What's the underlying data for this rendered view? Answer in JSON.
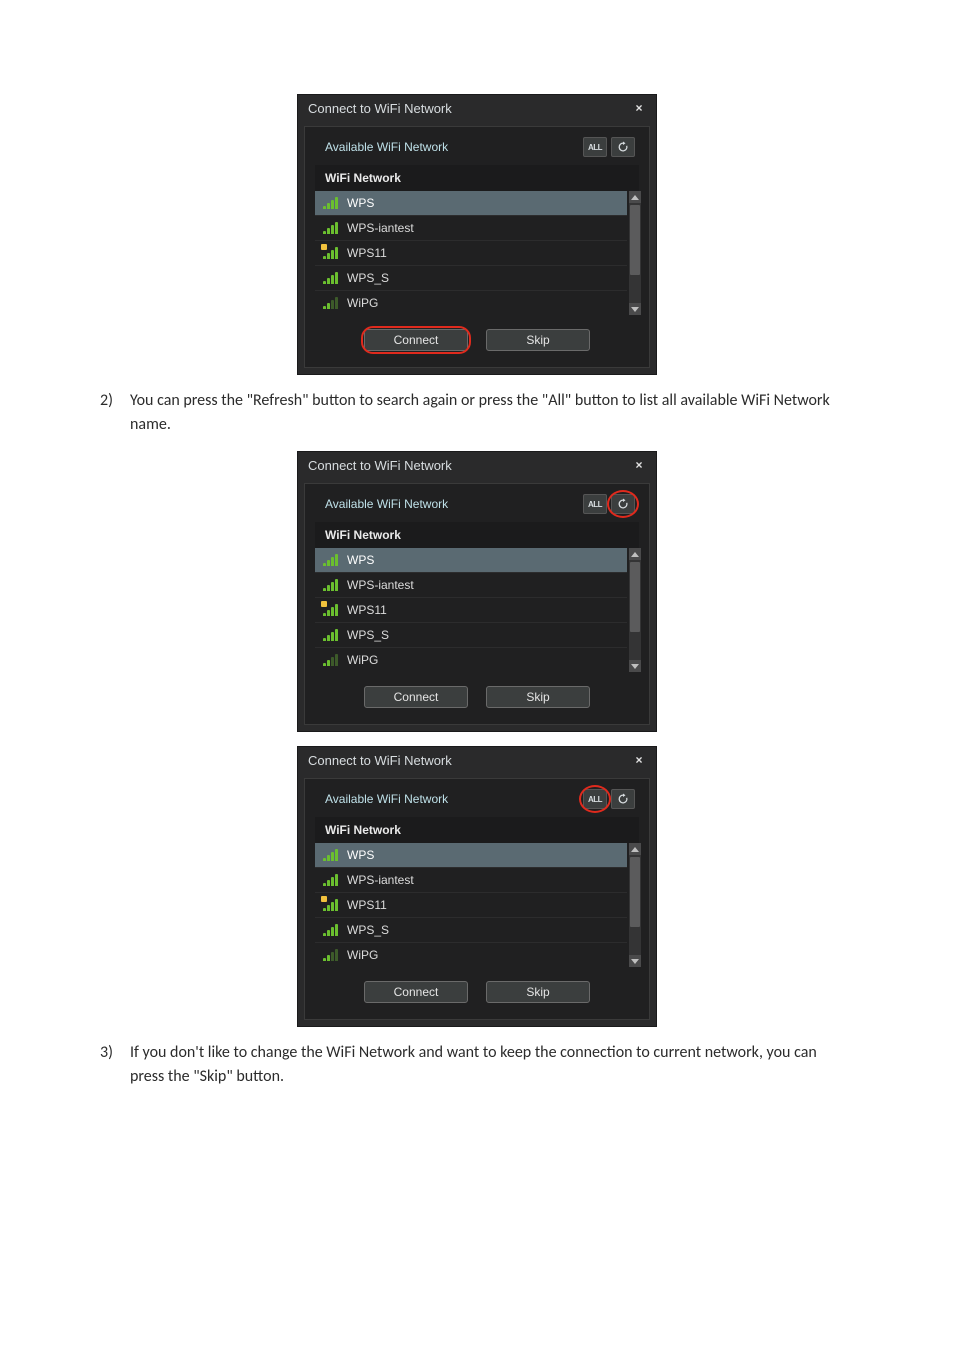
{
  "paragraphs": {
    "p2_marker": "2)",
    "p2_text": "You can press the \"Refresh\" button to search again or press the \"All\" button to list all available WiFi Network name.",
    "p3_marker": "3)",
    "p3_text": "If you don't like to change the WiFi Network and want to keep the connection to current network, you can press the \"Skip\" button."
  },
  "dialog": {
    "title": "Connect to WiFi Network",
    "close": "×",
    "available": "Available WiFi Network",
    "all_btn": "ALL",
    "header": "WiFi Network",
    "connect": "Connect",
    "skip": "Skip",
    "networks": [
      {
        "name": "WPS",
        "selected": true,
        "strength": "full",
        "secure": false
      },
      {
        "name": "WPS-iantest",
        "selected": false,
        "strength": "full",
        "secure": false
      },
      {
        "name": "WPS11",
        "selected": false,
        "strength": "full",
        "secure": true
      },
      {
        "name": "WPS_S",
        "selected": false,
        "strength": "full",
        "secure": false
      },
      {
        "name": "WiPG",
        "selected": false,
        "strength": "low",
        "secure": false
      }
    ]
  }
}
